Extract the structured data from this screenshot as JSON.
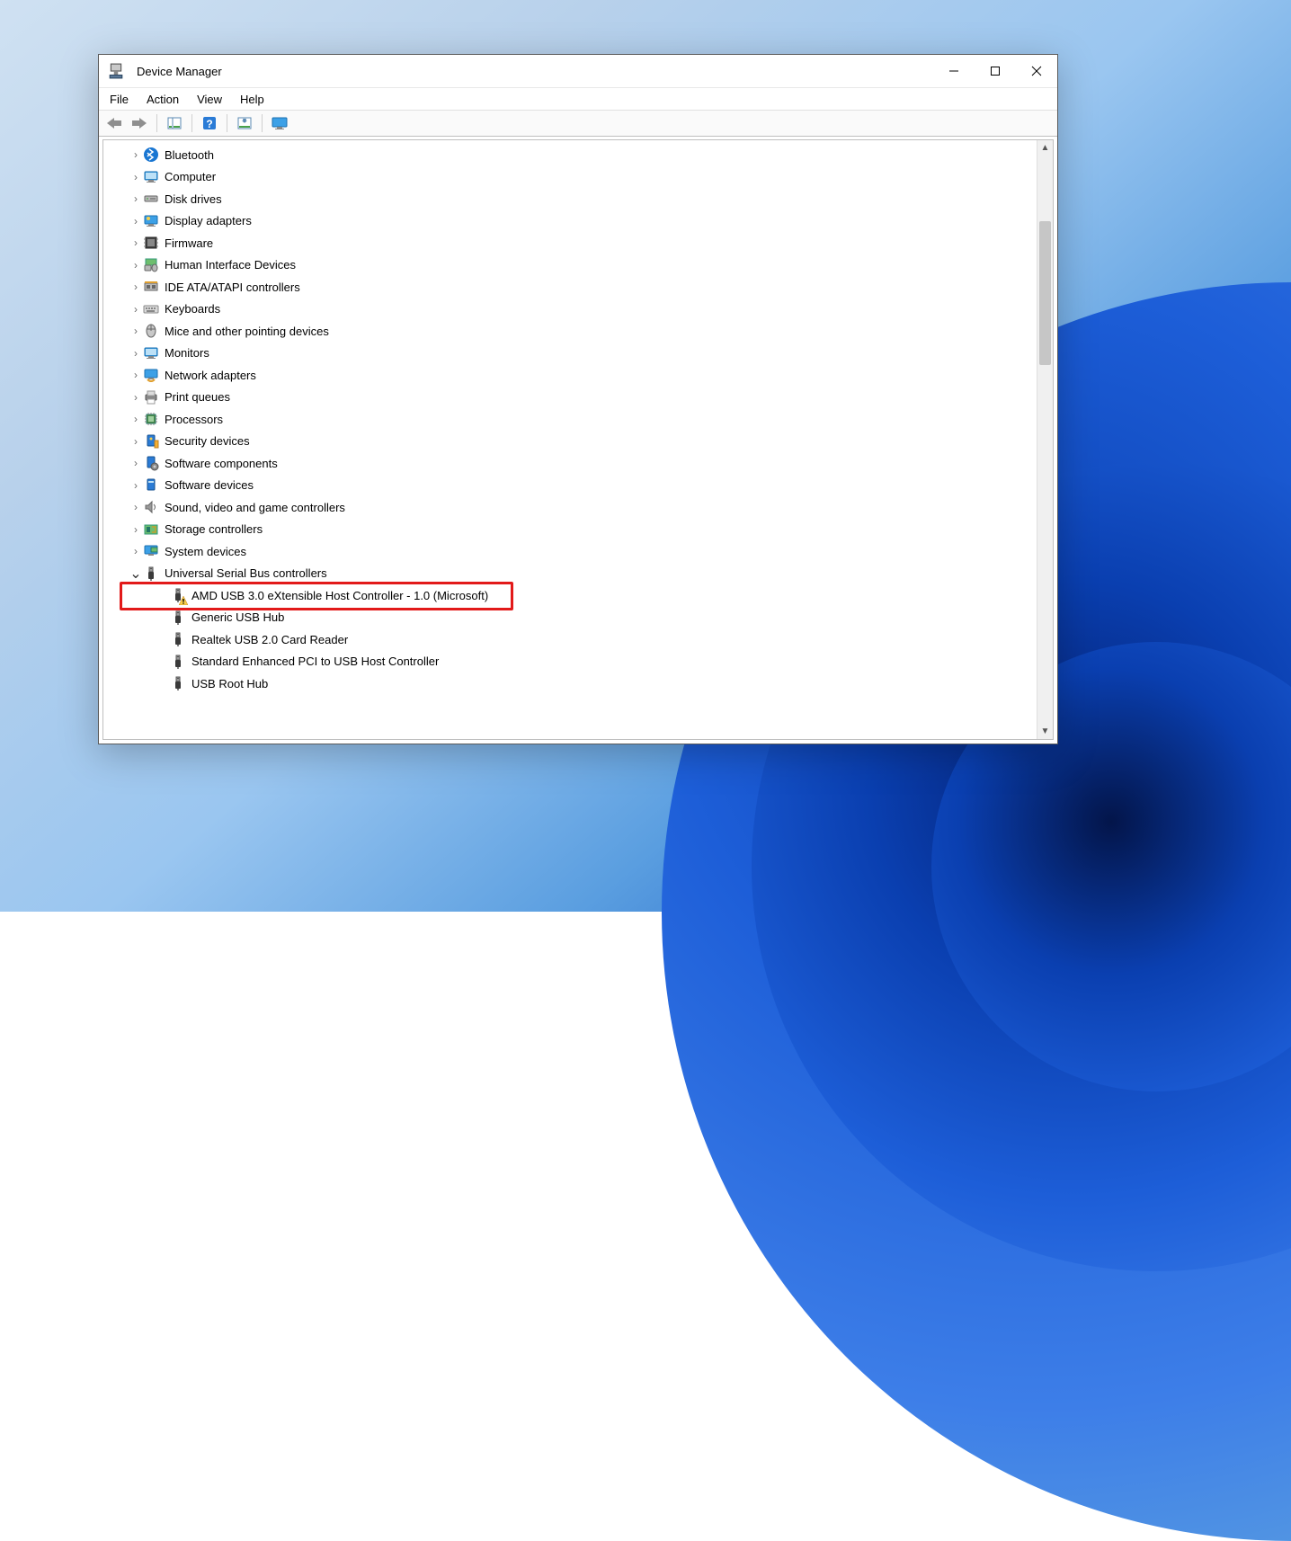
{
  "window": {
    "title": "Device Manager"
  },
  "menu": {
    "file": "File",
    "action": "Action",
    "view": "View",
    "help": "Help"
  },
  "tree": {
    "items": [
      {
        "label": "Bluetooth",
        "icon": "bluetooth",
        "expanded": false
      },
      {
        "label": "Computer",
        "icon": "computer",
        "expanded": false
      },
      {
        "label": "Disk drives",
        "icon": "disk",
        "expanded": false
      },
      {
        "label": "Display adapters",
        "icon": "display",
        "expanded": false
      },
      {
        "label": "Firmware",
        "icon": "firmware",
        "expanded": false
      },
      {
        "label": "Human Interface Devices",
        "icon": "hid",
        "expanded": false
      },
      {
        "label": "IDE ATA/ATAPI controllers",
        "icon": "ide",
        "expanded": false
      },
      {
        "label": "Keyboards",
        "icon": "keyboard",
        "expanded": false
      },
      {
        "label": "Mice and other pointing devices",
        "icon": "mouse",
        "expanded": false
      },
      {
        "label": "Monitors",
        "icon": "monitor",
        "expanded": false
      },
      {
        "label": "Network adapters",
        "icon": "network",
        "expanded": false
      },
      {
        "label": "Print queues",
        "icon": "printer",
        "expanded": false
      },
      {
        "label": "Processors",
        "icon": "cpu",
        "expanded": false
      },
      {
        "label": "Security devices",
        "icon": "security",
        "expanded": false
      },
      {
        "label": "Software components",
        "icon": "swcomp",
        "expanded": false
      },
      {
        "label": "Software devices",
        "icon": "swdev",
        "expanded": false
      },
      {
        "label": "Sound, video and game controllers",
        "icon": "sound",
        "expanded": false
      },
      {
        "label": "Storage controllers",
        "icon": "storage",
        "expanded": false
      },
      {
        "label": "System devices",
        "icon": "system",
        "expanded": false
      },
      {
        "label": "Universal Serial Bus controllers",
        "icon": "usb",
        "expanded": true
      }
    ],
    "usb_children": [
      {
        "label": "AMD USB 3.0 eXtensible Host Controller - 1.0 (Microsoft)",
        "icon": "usb",
        "warning": true,
        "highlighted": true
      },
      {
        "label": "Generic USB Hub",
        "icon": "usb"
      },
      {
        "label": "Realtek USB 2.0 Card Reader",
        "icon": "usb"
      },
      {
        "label": "Standard Enhanced PCI to USB Host Controller",
        "icon": "usb"
      },
      {
        "label": "USB Root Hub",
        "icon": "usb"
      }
    ]
  }
}
